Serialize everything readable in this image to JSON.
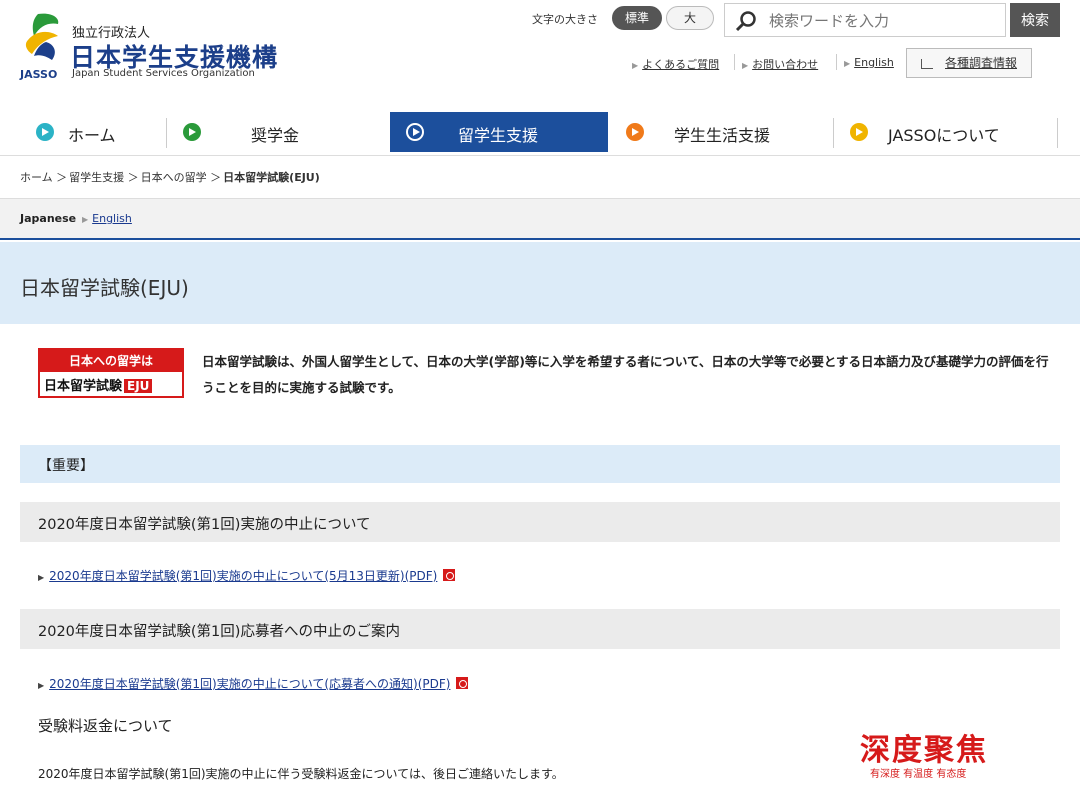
{
  "header": {
    "org_type": "独立行政法人",
    "org_name": "日本学生支援機構",
    "org_name_en": "Japan Student Services Organization",
    "logo_abbr": "JASSO",
    "font_size_label": "文字の大きさ",
    "font_size_standard": "標準",
    "font_size_large": "大",
    "search_placeholder": "検索ワードを入力",
    "search_button": "検索",
    "util_links": [
      "よくあるご質問",
      "お問い合わせ",
      "English"
    ],
    "survey_label": "各種調査情報"
  },
  "nav": {
    "items": [
      {
        "label": "ホーム",
        "color": "#2bb3c6"
      },
      {
        "label": "奨学金",
        "color": "#2a9a3a"
      },
      {
        "label": "留学生支援",
        "color": "#1c4f9c"
      },
      {
        "label": "学生生活支援",
        "color": "#f07a1a"
      },
      {
        "label": "JASSOについて",
        "color": "#f0b400"
      }
    ],
    "active_index": 2
  },
  "breadcrumb": [
    "ホーム",
    "留学生支援",
    "日本への留学",
    "日本留学試験(EJU)"
  ],
  "lang": {
    "current": "Japanese",
    "other": "English"
  },
  "page_title": "日本留学試験(EJU)",
  "badge": {
    "top": "日本への留学は",
    "bottom": "日本留学試験",
    "tag": "EJU"
  },
  "intro": "日本留学試験は、外国人留学生として、日本の大学(学部)等に入学を希望する者について、日本の大学等で必要とする日本語力及び基礎学力の評価を行うことを目的に実施する試験です。",
  "important_label": "【重要】",
  "sections": [
    {
      "heading": "2020年度日本留学試験(第1回)実施の中止について",
      "link": "2020年度日本留学試験(第1回)実施の中止について(5月13日更新)(PDF)"
    },
    {
      "heading": "2020年度日本留学試験(第1回)応募者への中止のご案内",
      "link": "2020年度日本留学試験(第1回)実施の中止について(応募者への通知)(PDF)"
    }
  ],
  "refund": {
    "heading": "受験料返金について",
    "text": "2020年度日本留学試験(第1回)実施の中止に伴う受験料返金については、後日ご連絡いたします。"
  },
  "watermark": {
    "main": "深度聚焦",
    "sub": "有深度 有温度 有态度"
  }
}
